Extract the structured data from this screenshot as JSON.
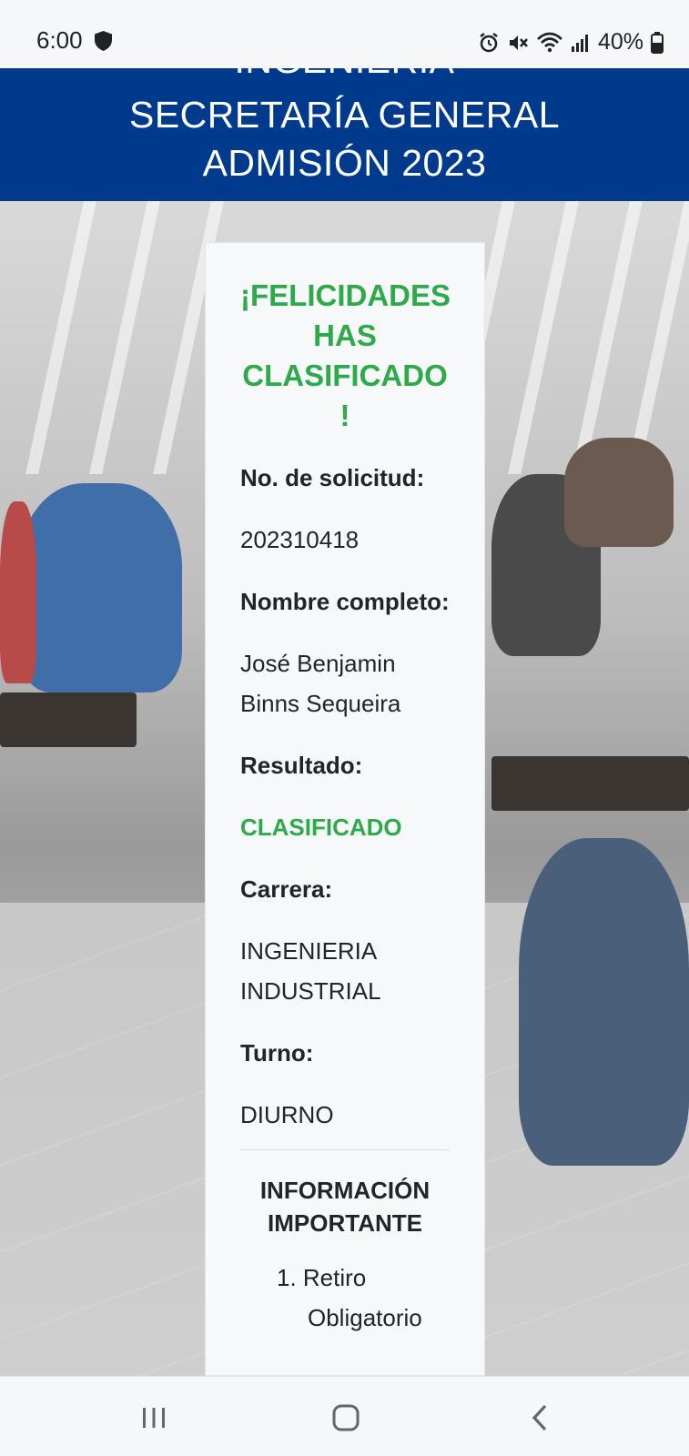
{
  "status_bar": {
    "time": "6:00",
    "battery": "40%",
    "icons": [
      "shield-icon",
      "alarm-icon",
      "mute-icon",
      "wifi-icon",
      "signal-icon",
      "battery-icon"
    ]
  },
  "header": {
    "cut_line": "INGENIERIA",
    "line1": "SECRETARÍA GENERAL",
    "line2": "ADMISIÓN 2023",
    "bg_color": "#003a8c"
  },
  "card": {
    "congrats": "¡FELICIDADES HAS CLASIFICADO !",
    "fields": {
      "request_label": "No. de solicitud:",
      "request_value": "202310418",
      "name_label": "Nombre completo:",
      "name_value": "José Benjamin Binns Sequeira",
      "result_label": "Resultado:",
      "result_value": "CLASIFICADO",
      "career_label": "Carrera:",
      "career_value": "INGENIERIA INDUSTRIAL",
      "shift_label": "Turno:",
      "shift_value": "DIURNO"
    },
    "info_title": "INFORMACIÓN IMPORTANTE",
    "info_items": [
      "1. Retiro",
      "Obligatorio"
    ],
    "accent_green": "#2eaa4a"
  },
  "nav_bar": {
    "icons": [
      "recent-apps-icon",
      "home-icon",
      "back-icon"
    ]
  }
}
